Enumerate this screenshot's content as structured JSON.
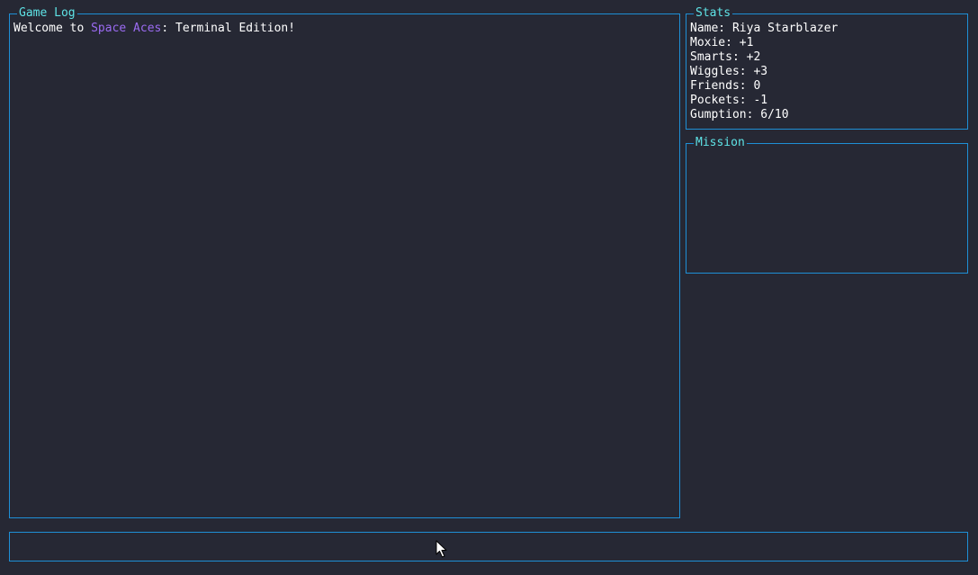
{
  "log": {
    "title": "Game Log",
    "welcome_prefix": "Welcome to ",
    "game_name": "Space Aces",
    "welcome_suffix": ": Terminal Edition!"
  },
  "stats": {
    "title": "Stats",
    "lines": [
      "Name: Riya Starblazer",
      "Moxie: +1",
      "Smarts: +2",
      "Wiggles: +3",
      "Friends: 0",
      "Pockets: -1",
      "Gumption: 6/10"
    ]
  },
  "mission": {
    "title": "Mission"
  },
  "input": {
    "value": ""
  },
  "colors": {
    "background": "#262834",
    "border": "#1e8fd6",
    "title": "#5ee3e6",
    "highlight": "#9b6bf2",
    "text": "#ffffff"
  },
  "icons": {
    "cursor": "mouse-pointer-icon"
  }
}
